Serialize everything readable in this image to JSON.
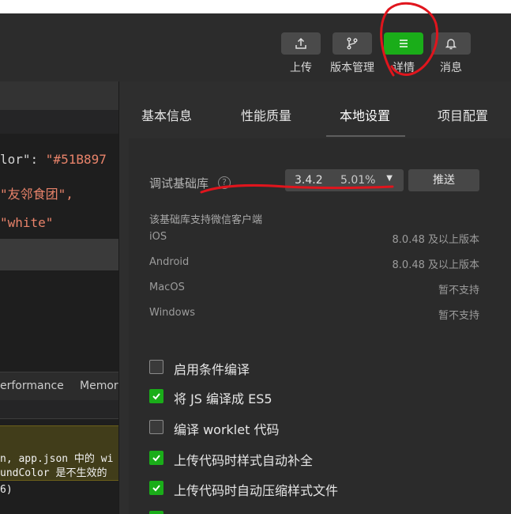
{
  "toolbar": {
    "buttons": [
      {
        "label": "上传",
        "icon": "upload-icon"
      },
      {
        "label": "版本管理",
        "icon": "branch-icon"
      },
      {
        "label": "详情",
        "icon": "menu-icon",
        "active": true
      },
      {
        "label": "消息",
        "icon": "bell-icon"
      }
    ]
  },
  "editor": {
    "lines": [
      {
        "key": "lor\": ",
        "value": "\"#51B897"
      },
      {
        "key": "",
        "value": "\"友邻食团\","
      },
      {
        "key": "",
        "value": "\"white\""
      }
    ]
  },
  "devtools": {
    "tabs": [
      "erformance",
      "Memor"
    ],
    "warning_line1": "n, app.json 中的 wi",
    "warning_line2": "undColor 是不生效的",
    "paren_text": "6)"
  },
  "panel": {
    "tabs": [
      "基本信息",
      "性能质量",
      "本地设置",
      "项目配置"
    ],
    "active_tab": "本地设置",
    "debug_lib": {
      "label": "调试基础库",
      "help": "?",
      "version": "3.4.2",
      "percent": "5.01%",
      "push_label": "推送"
    },
    "support_note": "该基础库支持微信客户端",
    "platforms": [
      {
        "name": "iOS",
        "support": "8.0.48 及以上版本"
      },
      {
        "name": "Android",
        "support": "8.0.48 及以上版本"
      },
      {
        "name": "MacOS",
        "support": "暂不支持"
      },
      {
        "name": "Windows",
        "support": "暂不支持"
      }
    ],
    "options": [
      {
        "label": "启用条件编译",
        "checked": false
      },
      {
        "label": "将 JS 编译成 ES5",
        "checked": true
      },
      {
        "label": "编译 worklet 代码",
        "checked": false
      },
      {
        "label": "上传代码时样式自动补全",
        "checked": true
      },
      {
        "label": "上传代码时自动压缩样式文件",
        "checked": true
      }
    ]
  },
  "colors": {
    "accent_green": "#1aad19",
    "annotation_red": "#e0151d"
  }
}
